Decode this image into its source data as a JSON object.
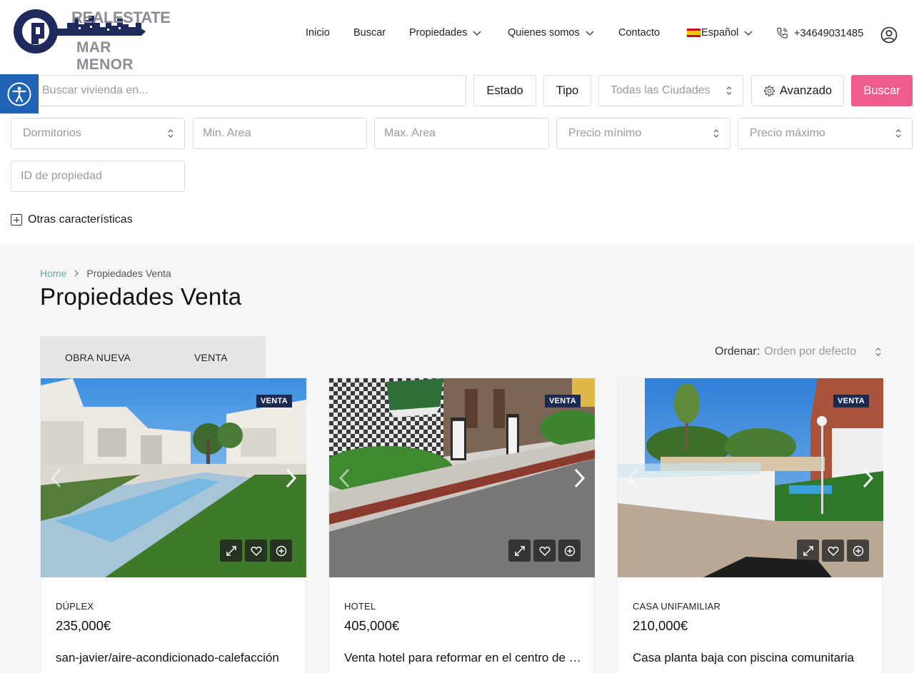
{
  "brand": {
    "line1": "REALESTATE",
    "line2": "MAR MENOR",
    "color": "#1f2a5c"
  },
  "nav": {
    "inicio": "Inicio",
    "buscar": "Buscar",
    "propiedades": "Propiedades",
    "quienes": "Quienes somos",
    "contacto": "Contacto",
    "language": "Español",
    "phone": "+34649031485"
  },
  "search": {
    "keyword_placeholder": "Buscar vivienda en...",
    "estado": "Estado",
    "tipo": "Tipo",
    "ciudad": "Todas las Ciudades",
    "avanzado": "Avanzado",
    "submit": "Buscar",
    "dormitorios": "Dormitorios",
    "min_area": "Min. Area",
    "max_area": "Max. Area",
    "precio_min": "Precio mínimo",
    "precio_max": "Precio máximo",
    "id_propiedad": "ID de propiedad",
    "otras": "Otras características",
    "accent": "#ef5d8c"
  },
  "breadcrumb": {
    "home": "Home",
    "current": "Propiedades Venta"
  },
  "page_title": "Propiedades Venta",
  "tabs": [
    "OBRA NUEVA",
    "VENTA"
  ],
  "sort": {
    "label": "Ordenar:",
    "value": "Orden por defecto"
  },
  "listings": [
    {
      "badge": "VENTA",
      "type": "DÚPLEX",
      "price": "235,000€",
      "title": "san-javier/aire-acondicionado-calefacción"
    },
    {
      "badge": "VENTA",
      "type": "HOTEL",
      "price": "405,000€",
      "title": "Venta hotel para reformar en el centro de San Javier"
    },
    {
      "badge": "VENTA",
      "type": "CASA UNIFAMILIAR",
      "price": "210,000€",
      "title": "Casa planta baja con piscina comunitaria"
    }
  ]
}
